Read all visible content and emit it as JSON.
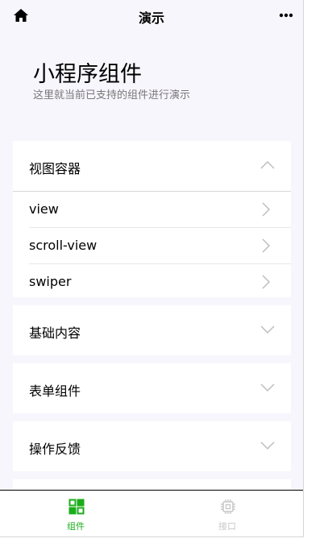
{
  "navbar": {
    "title": "演示"
  },
  "header": {
    "title": "小程序组件",
    "description": "这里就当前已支持的组件进行演示"
  },
  "sections": [
    {
      "label": "视图容器",
      "expanded": true,
      "items": [
        "view",
        "scroll-view",
        "swiper"
      ]
    },
    {
      "label": "基础内容",
      "expanded": false
    },
    {
      "label": "表单组件",
      "expanded": false
    },
    {
      "label": "操作反馈",
      "expanded": false
    }
  ],
  "tabbar": {
    "tabs": [
      {
        "label": "组件",
        "icon": "grid-icon",
        "active": true,
        "color": "#1aad19"
      },
      {
        "label": "接口",
        "icon": "chip-icon",
        "active": false,
        "color": "#c8c8c8"
      }
    ]
  },
  "colors": {
    "background": "#f8f6fd",
    "accent": "#1aad19",
    "inactive": "#c8c8c8"
  }
}
